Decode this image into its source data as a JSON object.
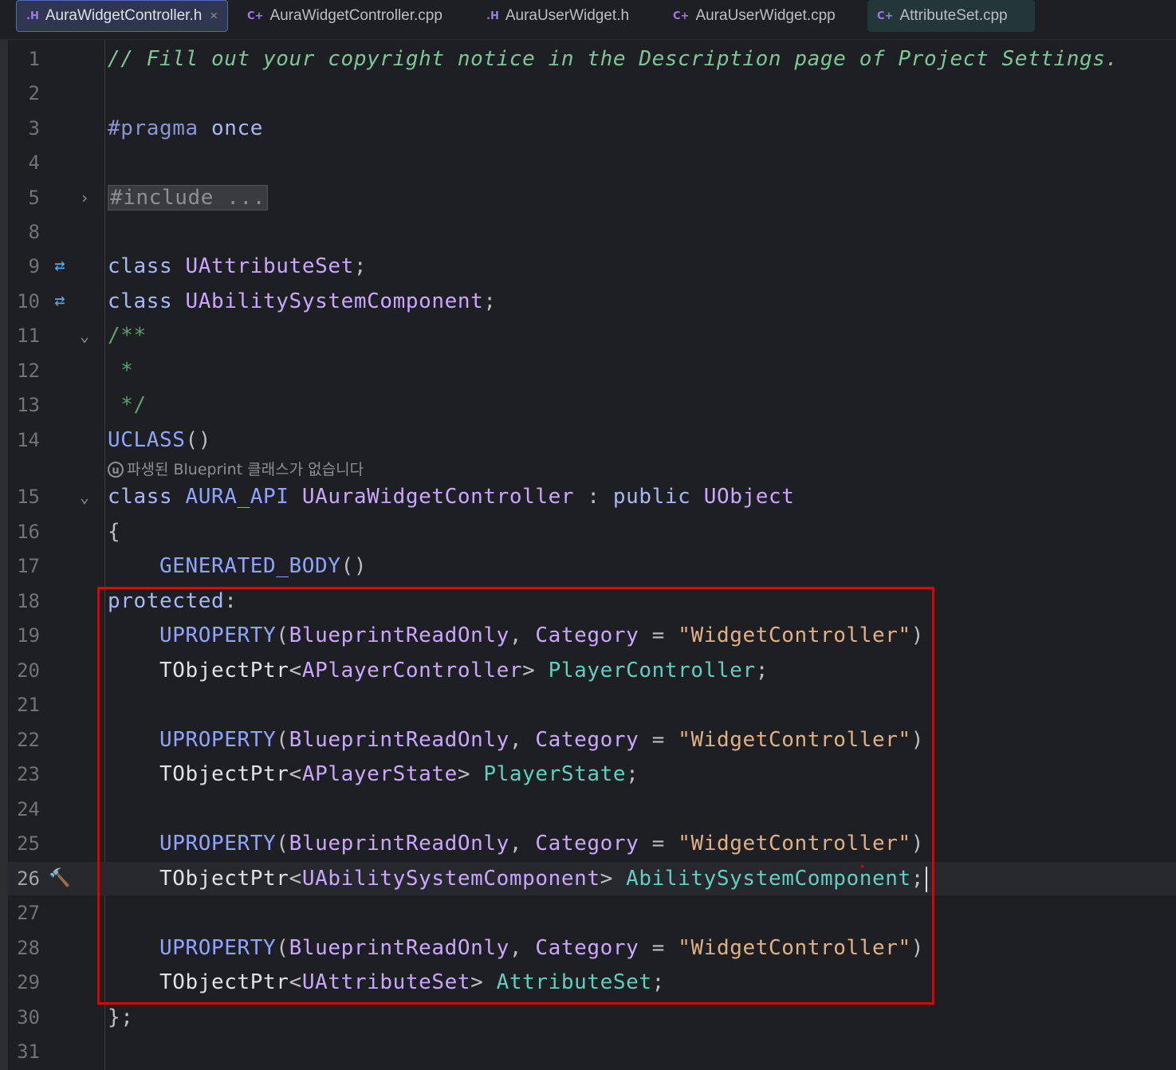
{
  "tabs": [
    {
      "icon": ".H",
      "label": "AuraWidgetController.h",
      "close": "×"
    },
    {
      "icon": "C+",
      "label": "AuraWidgetController.cpp"
    },
    {
      "icon": ".H",
      "label": "AuraUserWidget.h"
    },
    {
      "icon": "C+",
      "label": "AuraUserWidget.cpp"
    },
    {
      "icon": "C+",
      "label": "AttributeSet.cpp"
    }
  ],
  "line_numbers": [
    "1",
    "2",
    "3",
    "4",
    "5",
    "8",
    "9",
    "10",
    "11",
    "12",
    "13",
    "14",
    "15",
    "16",
    "17",
    "18",
    "19",
    "20",
    "21",
    "22",
    "23",
    "24",
    "25",
    "26",
    "27",
    "28",
    "29",
    "30",
    "31"
  ],
  "code": {
    "l1": "// Fill out your copyright notice in the Description page of Project Settings.",
    "l3a": "#pragma",
    "l3b": " once",
    "l5": "#include ...",
    "l9a": "class",
    "l9b": " UAttributeSet",
    "l9c": ";",
    "l10a": "class",
    "l10b": " UAbilitySystemComponent",
    "l10c": ";",
    "l11": "/**",
    "l12": " *",
    "l13": " */",
    "l14a": "UCLASS",
    "l14b": "()",
    "l15a": "class",
    "l15b": " AURA_API",
    "l15c": " UAuraWidgetController",
    "l15d": " : ",
    "l15e": "public",
    "l15f": " UObject",
    "l16": "{",
    "l17a": "    GENERATED_BODY",
    "l17b": "()",
    "l18a": "protected",
    "l18b": ":",
    "uprop": "    UPROPERTY",
    "paren_open": "(",
    "bro": "BlueprintReadOnly",
    "comma": ", ",
    "category": "Category",
    "eq": " = ",
    "catval": "\"WidgetController\"",
    "paren_close": ")",
    "tptr": "    TObjectPtr",
    "lt": "<",
    "gt": "> ",
    "semi": ";",
    "l20type": "APlayerController",
    "l20name": "PlayerController",
    "l23type": "APlayerState",
    "l23name": "PlayerState",
    "l26type": "UAbilitySystemComponent",
    "l26name": "AbilitySystemComponent",
    "l29type": "UAttributeSet",
    "l29name": "AttributeSet",
    "l30": "};"
  },
  "hint": {
    "logo": "u",
    "text": "파생된 Blueprint 클래스가 없습니다"
  },
  "icons": {
    "fold_closed": "chevron-right-icon",
    "fold_open": "chevron-down-icon",
    "related": "navigate-related-icon",
    "build": "hammer-icon"
  },
  "colors": {
    "highlight_box": "#e00000",
    "background": "#1e1f22"
  }
}
